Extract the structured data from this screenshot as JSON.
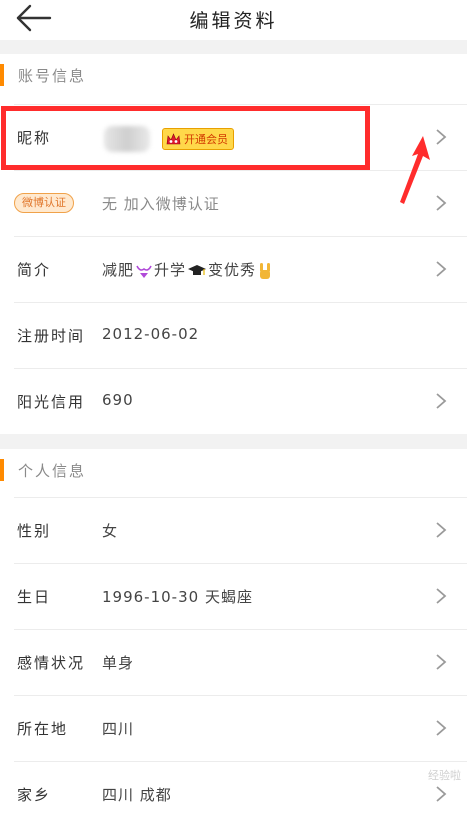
{
  "header": {
    "title": "编辑资料"
  },
  "sections": {
    "account": {
      "title": "账号信息"
    },
    "personal": {
      "title": "个人信息"
    }
  },
  "rows": {
    "nickname": {
      "label": "昵称",
      "vip_label": "开通会员"
    },
    "verify": {
      "badge": "微博认证",
      "value": "无 加入微博认证"
    },
    "bio": {
      "label": "简介",
      "value_parts": [
        "减肥",
        "升学",
        "变优秀"
      ]
    },
    "register": {
      "label": "注册时间",
      "value": "2012-06-02"
    },
    "credit": {
      "label": "阳光信用",
      "value": "690"
    },
    "gender": {
      "label": "性别",
      "value": "女"
    },
    "birthday": {
      "label": "生日",
      "value": "1996-10-30 天蝎座"
    },
    "relationship": {
      "label": "感情状况",
      "value": "单身"
    },
    "location": {
      "label": "所在地",
      "value": "四川"
    },
    "hometown": {
      "label": "家乡",
      "value": "四川 成都"
    }
  },
  "watermark": "经验啦",
  "colors": {
    "accent": "#ff8a00",
    "highlight": "#ff2c2c",
    "vip_badge": "#ffd84a"
  },
  "icons": [
    "back-arrow-icon",
    "chevron-right-icon",
    "crown-icon",
    "bikini-emoji",
    "graduation-cap-emoji",
    "rock-hand-emoji"
  ]
}
